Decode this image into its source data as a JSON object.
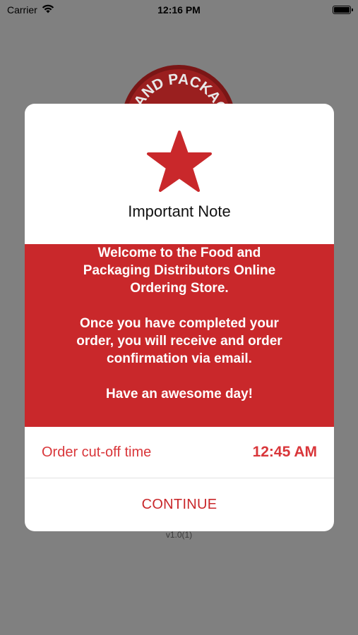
{
  "status_bar": {
    "carrier": "Carrier",
    "time": "12:16 PM",
    "wifi_icon": "wifi-icon",
    "battery_icon": "battery-icon"
  },
  "background": {
    "logo_text": "D AND PACKAG",
    "version": "v1.0(1)"
  },
  "modal": {
    "icon": "star-icon",
    "title": "Important Note",
    "message_lines_1": [
      "Welcome to the Food and",
      "Packaging Distributors Online",
      "Ordering Store."
    ],
    "message_lines_2": [
      "Once you have completed your",
      "order, you will receive and order",
      "confirmation via email."
    ],
    "message_lines_3": [
      "Have an awesome day!"
    ],
    "cutoff_label": "Order cut-off time",
    "cutoff_time": "12:45 AM",
    "continue_label": "CONTINUE"
  },
  "colors": {
    "accent": "#c9282b",
    "overlay": "#808080"
  }
}
